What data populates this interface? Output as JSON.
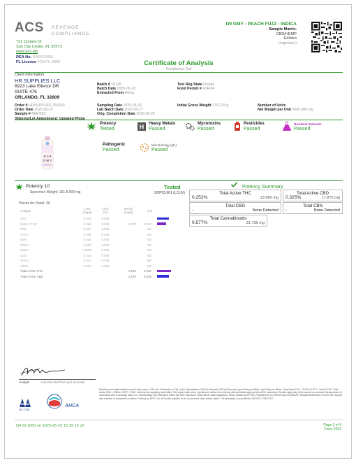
{
  "header": {
    "logo_main": "ACS",
    "logo_sub_1": "SEVENGE",
    "logo_sub_2": "COMPLIANCE",
    "address_1": "721 Cortaro Dr",
    "address_2": "Sun City Center, FL 33573",
    "address_3": "www.acs.lab",
    "dea_label": "DEA No.",
    "dea_value": "RA0519036",
    "fl_label": "FL License",
    "fl_value": "#CMTL-0003"
  },
  "product": {
    "title": "D9 GMY - PEACH FUZZ - INDICA",
    "matrix": "Sample Matrix:",
    "matrix_value": "CBD/HEMP",
    "type": "Edibles",
    "route": "(Ingestion)"
  },
  "coa": {
    "title": "Certificate of Analysis",
    "subtitle": "Compliance Test"
  },
  "client": {
    "label": "Client Information:",
    "name": "HR SUPPLIES LLC",
    "address_1": "6923 Lake Ellenor DR",
    "address_2": "SUITE 476",
    "city": "ORLANDO, FL 32809",
    "order_label": "Order #",
    "order_value": "HRSUPPLIES-250603",
    "order_date_label": "Order Date",
    "order_date_value": "2025-05-15",
    "sample_label": "Sample #",
    "sample_value": "AAEI553",
    "note": "35Gems/Lot Amendment: Updated Photo"
  },
  "batch": {
    "batch_label": "Batch #",
    "batch_value": "10126",
    "batch_date_label": "Batch Date",
    "batch_date_value": "2025-05-18",
    "extracted_label": "Extracted From",
    "extracted_value": "Hemp",
    "sampling_label": "Sampling Date",
    "sampling_value": "2025-05-15",
    "lab_batch_label": "Lab Batch Date",
    "lab_batch_value": "2025-05-17",
    "completion_label": "Orig. Completion Date",
    "completion_value": "2025-05-25"
  },
  "regs": {
    "test_reg_label": "Test Reg State",
    "test_reg_value": "Florida",
    "food_permit_label": "Food Permit #",
    "food_permit_value": "434454",
    "initial_gross_label": "Initial Gross Weight",
    "initial_gross_value": "274.278 g",
    "units_label": "Number of Units",
    "units_value": "",
    "net_weight_label": "Net Weight per Unit",
    "net_weight_value": "5500.000 mg"
  },
  "badges": {
    "potency": "Potency",
    "potency_status": "Tested",
    "heavy_metals": "Heavy Metals",
    "heavy_metals_status": "Passed",
    "mycotoxins": "Mycotoxins",
    "mycotoxins_status": "Passed",
    "pesticides": "Pesticides",
    "pesticides_status": "Passed",
    "residual_solvents": "Residual Solvents",
    "residual_solvents_status": "Passed",
    "pathogenic": "Pathogenic",
    "pathogenic_status": "Passed",
    "microbiology": "Microbiology (Qc)",
    "microbiology_status": "Passed"
  },
  "sample_photo_label": "D 4 8\nG M Y",
  "potency": {
    "title": "Potency 10",
    "status": "Tested",
    "specimen": "Specimen Weight: 151.8 000 mg",
    "method": "SOP15.001 (LCUV)",
    "pieces": "Pieces for Panel: 30",
    "columns": [
      "Analyte",
      "LOD (mg/g)",
      "LOQ (%)",
      "Result (mg/g)",
      "(%)"
    ],
    "rows": [
      {
        "analyte": "CBC",
        "lod": "0.014",
        "loq": "0.005",
        "result": "",
        "pct": "",
        "bar": 0.6,
        "color": "#2b2bd8"
      },
      {
        "analyte": "Delta 9 THC",
        "lod": "0.024",
        "loq": "0.005",
        "result": "2.570",
        "pct": "0.252",
        "bar": 0.48,
        "color": "#7a26c9"
      },
      {
        "analyte": "CBD",
        "lod": "0.021",
        "loq": "0.005",
        "result": "",
        "pct": "ND",
        "bar": 0,
        "color": "#2b2bd8"
      },
      {
        "analyte": "THCA",
        "lod": "0.018",
        "loq": "0.005",
        "result": "",
        "pct": "ND",
        "bar": 0,
        "color": "#2b2bd8"
      },
      {
        "analyte": "CBN",
        "lod": "0.016",
        "loq": "0.005",
        "result": "",
        "pct": "ND",
        "bar": 0,
        "color": "#2b2bd8"
      },
      {
        "analyte": "CBGA",
        "lod": "0.013",
        "loq": "0.005",
        "result": "",
        "pct": "ND",
        "bar": 0,
        "color": "#2b2bd8"
      },
      {
        "analyte": "CBDA",
        "lod": "0.0025",
        "loq": "0.005",
        "result": "",
        "pct": "ND",
        "bar": 0,
        "color": "#2b2bd8"
      },
      {
        "analyte": "CBG",
        "lod": "0.016",
        "loq": "0.005",
        "result": "",
        "pct": "ND",
        "bar": 0,
        "color": "#2b2bd8"
      },
      {
        "analyte": "THCV",
        "lod": "0.011",
        "loq": "0.005",
        "result": "",
        "pct": "ND",
        "bar": 0,
        "color": "#2b2bd8"
      },
      {
        "analyte": "CBDV",
        "lod": "0.014",
        "loq": "0.005",
        "result": "",
        "pct": "ND",
        "bar": 0,
        "color": "#2b2bd8"
      },
      {
        "analyte": "Total Active THC",
        "lod": "",
        "loq": "",
        "result": "2.520",
        "pct": "0.252",
        "bar": 0.7,
        "color": "#7a26c9"
      },
      {
        "analyte": "Total Active CBD",
        "lod": "",
        "loq": "",
        "result": "2.570",
        "pct": "0.325",
        "bar": 0.6,
        "color": "#2b2bd8"
      }
    ]
  },
  "summary": {
    "title": "Potency Summary",
    "boxes": [
      {
        "label": "Total Active THC",
        "pct": "0.252%",
        "mg": "13.860 mg"
      },
      {
        "label": "Total Active CBD",
        "pct": "0.325%",
        "mg": "17.875 mg"
      },
      {
        "label": "Total CBG",
        "pct": "-",
        "mg": "None Detected"
      },
      {
        "label": "Total CBN",
        "pct": "-",
        "mg": "None Detected"
      },
      {
        "label": "Total Cannabinoids",
        "pct": "0.577%",
        "mg": "31.735 mg"
      }
    ]
  },
  "footer": {
    "signer": "Analyst",
    "signer_title": "Lab Director/Principal Scientist",
    "fine_print": "Definitions and abbreviations used in this report: LOD Limit of Detection, LOQ Limit of Quantitation, ND Not Detected, NR Not Reported, ppm Parts per Million, ppb Parts per Billion, Total Active THC = THCA x 0.877 + Delta 9 THC. Total Active CBD = CBDA x 0.877 + CBD. Limits set by regulatory authorities. This report shall not be reproduced, unless in its entirety, without written approval from ACS Laboratory. Results apply only to the sample as received. Measurement of uncertainty with a coverage factor k=2. Microbiology and Pathogens tested per SOP. Mycotoxin Pass/Fail per state regulations. Heavy Metals by ICP-MS. Pesticides by LC-MS/MS and GC-MS/MS. Residual Solvents by HS-GC-MS. Sample was received in acceptable condition. Potency by HPLC-UV. All results reported on an as-received basis unless stated. The laboratory is accredited to ISO/IEC 17025:2017.",
    "printed": "Q4 St  1050 on 2025-05-25 15:29:12 v2",
    "page": "Page 1 of 4",
    "form": "Form F022"
  }
}
